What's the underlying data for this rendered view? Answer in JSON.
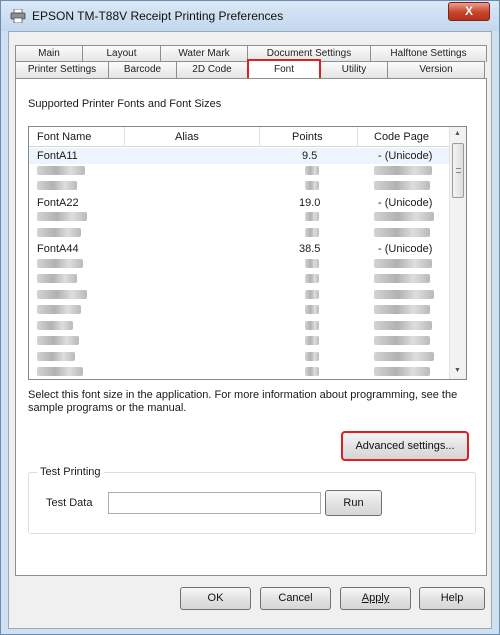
{
  "window": {
    "title": "EPSON TM-T88V Receipt Printing Preferences",
    "close_label": "X"
  },
  "tabs": {
    "back_row": [
      "Main",
      "Layout",
      "Water Mark",
      "Document Settings",
      "Halftone Settings"
    ],
    "front_row": [
      "Printer Settings",
      "Barcode",
      "2D Code",
      "Font",
      "Utility",
      "Version"
    ],
    "active": "Font"
  },
  "font_page": {
    "heading": "Supported Printer Fonts and Font Sizes",
    "columns": [
      "Font Name",
      "Alias",
      "Points",
      "Code Page"
    ],
    "rows": [
      {
        "name": "FontA11",
        "alias": "",
        "points": "9.5",
        "code_page": "- (Unicode)"
      },
      {
        "name": "",
        "alias": "",
        "points": "",
        "code_page": ""
      },
      {
        "name": "",
        "alias": "",
        "points": "",
        "code_page": ""
      },
      {
        "name": "FontA22",
        "alias": "",
        "points": "19.0",
        "code_page": "- (Unicode)"
      },
      {
        "name": "",
        "alias": "",
        "points": "",
        "code_page": ""
      },
      {
        "name": "",
        "alias": "",
        "points": "",
        "code_page": ""
      },
      {
        "name": "FontA44",
        "alias": "",
        "points": "38.5",
        "code_page": "- (Unicode)"
      }
    ],
    "info_text": "Select this font size in the application. For more information about programming, see the sample programs or the manual.",
    "advanced_button": "Advanced settings...",
    "test_group": {
      "title": "Test Printing",
      "label": "Test Data",
      "input_value": "",
      "run_button": "Run"
    }
  },
  "footer": {
    "ok": "OK",
    "cancel": "Cancel",
    "apply": "Apply",
    "help": "Help"
  }
}
